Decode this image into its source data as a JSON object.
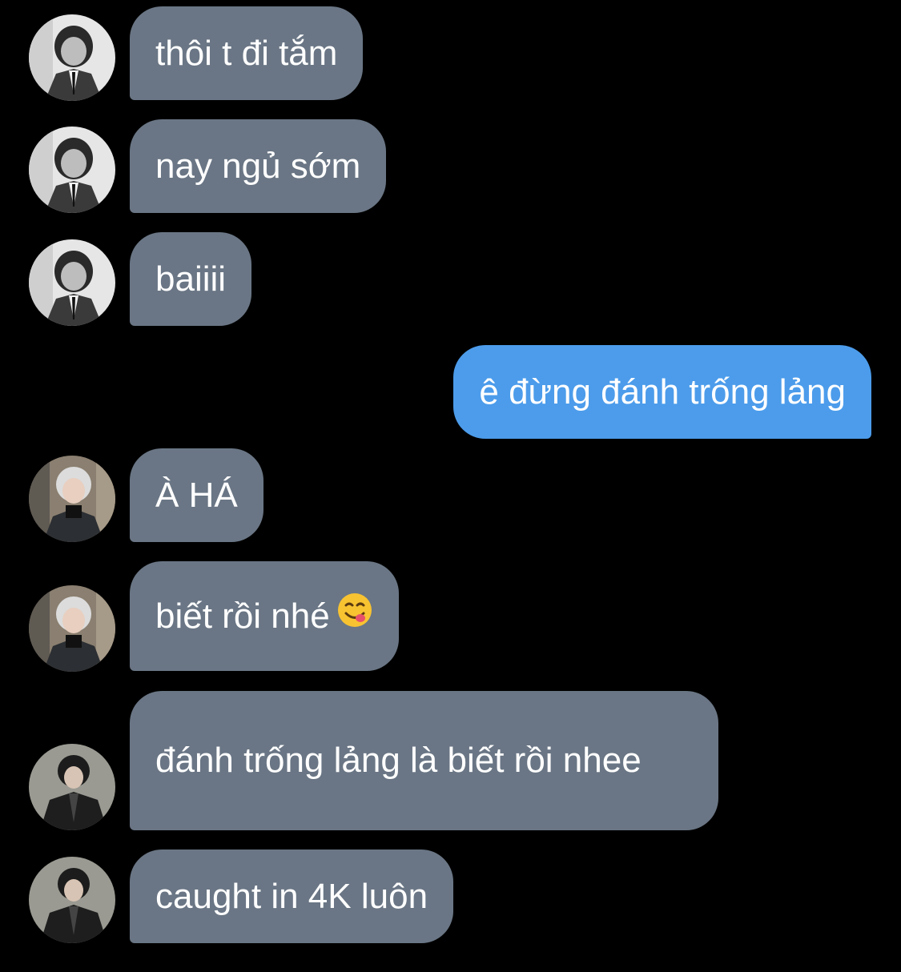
{
  "conversation": {
    "messages": [
      {
        "sender": "A",
        "text": "thôi t đi tắm"
      },
      {
        "sender": "A",
        "text": "nay ngủ sớm"
      },
      {
        "sender": "A",
        "text": "baiiii"
      },
      {
        "sender": "me",
        "text": "ê đừng đánh trống lảng"
      },
      {
        "sender": "B",
        "text": "À HÁ"
      },
      {
        "sender": "B",
        "text": "biết rồi nhé",
        "emoji": "face-savoring-food-emoji"
      },
      {
        "sender": "C",
        "text": "đánh trống lảng là biết rồi nhee"
      },
      {
        "sender": "C",
        "text": "caught in 4K luôn"
      }
    ]
  },
  "colors": {
    "background": "#000000",
    "incoming_bubble": "#6a7685",
    "outgoing_bubble": "#4c9ceb",
    "text": "#ffffff"
  }
}
